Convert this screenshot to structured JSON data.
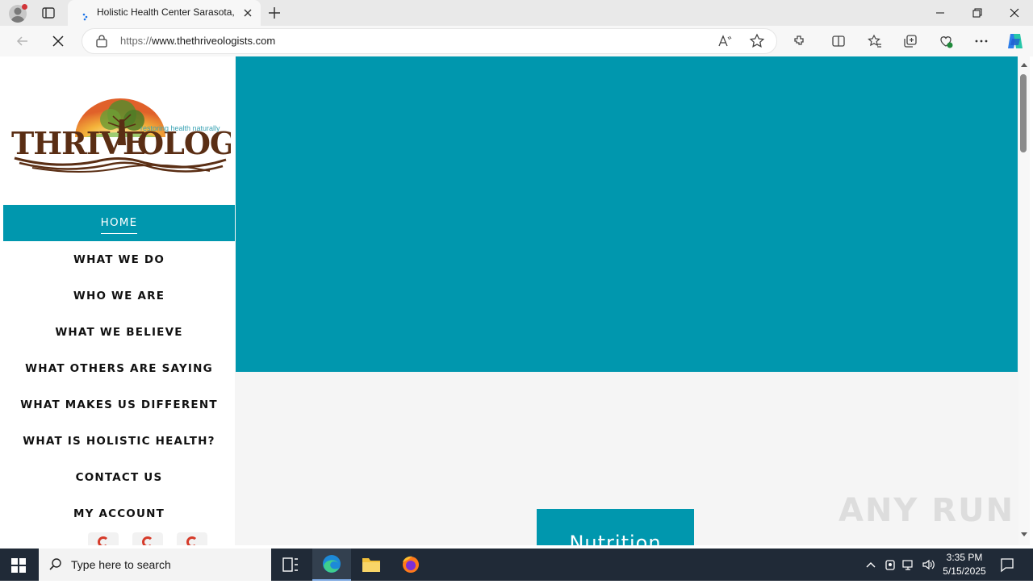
{
  "browser": {
    "tab_title": "Holistic Health Center Sarasota, F",
    "url_protocol": "https://",
    "url_host": "www.thethriveologists.com"
  },
  "logo": {
    "tagline": "restoring health naturally",
    "wordmark_left": "THRIVE",
    "wordmark_right": "OLOGY"
  },
  "nav": {
    "items": [
      {
        "label": "HOME"
      },
      {
        "label": "WHAT WE DO"
      },
      {
        "label": "WHO WE ARE"
      },
      {
        "label": "WHAT WE BELIEVE"
      },
      {
        "label": "WHAT OTHERS ARE SAYING"
      },
      {
        "label": "WHAT MAKES US DIFFERENT"
      },
      {
        "label": "WHAT IS HOLISTIC HEALTH?"
      },
      {
        "label": "CONTACT US"
      },
      {
        "label": "MY ACCOUNT"
      }
    ]
  },
  "main": {
    "card_title": "Nutrition"
  },
  "watermark": "ANY RUN",
  "taskbar": {
    "search_placeholder": "Type here to search",
    "time": "3:35 PM",
    "date": "5/15/2025"
  },
  "colors": {
    "accent": "#0097ae",
    "social_icon": "#d63b2a",
    "logo_brown": "#5a2e14"
  }
}
